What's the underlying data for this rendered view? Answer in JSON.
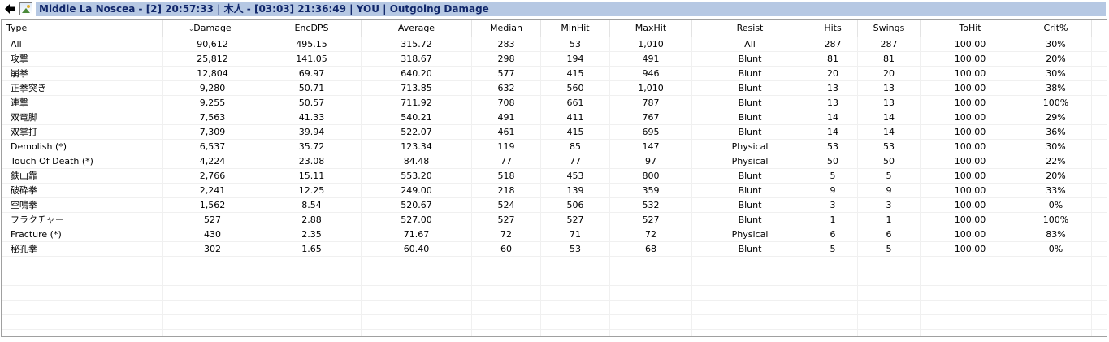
{
  "window": {
    "title": "Middle La Noscea - [2] 20:57:33 | 木人 - [03:03] 21:36:49 | YOU | Outgoing Damage",
    "back_icon": "back-arrow-icon",
    "image_icon": "picture-icon"
  },
  "table": {
    "columns": [
      "Type",
      "Damage",
      "EncDPS",
      "Average",
      "Median",
      "MinHit",
      "MaxHit",
      "Resist",
      "Hits",
      "Swings",
      "ToHit",
      "Crit%"
    ],
    "sorted_by": "Damage",
    "rows": [
      [
        "All",
        "90,612",
        "495.15",
        "315.72",
        "283",
        "53",
        "1,010",
        "All",
        "287",
        "287",
        "100.00",
        "30%"
      ],
      [
        "攻撃",
        "25,812",
        "141.05",
        "318.67",
        "298",
        "194",
        "491",
        "Blunt",
        "81",
        "81",
        "100.00",
        "20%"
      ],
      [
        "崩拳",
        "12,804",
        "69.97",
        "640.20",
        "577",
        "415",
        "946",
        "Blunt",
        "20",
        "20",
        "100.00",
        "30%"
      ],
      [
        "正拳突き",
        "9,280",
        "50.71",
        "713.85",
        "632",
        "560",
        "1,010",
        "Blunt",
        "13",
        "13",
        "100.00",
        "38%"
      ],
      [
        "連撃",
        "9,255",
        "50.57",
        "711.92",
        "708",
        "661",
        "787",
        "Blunt",
        "13",
        "13",
        "100.00",
        "100%"
      ],
      [
        "双竜脚",
        "7,563",
        "41.33",
        "540.21",
        "491",
        "411",
        "767",
        "Blunt",
        "14",
        "14",
        "100.00",
        "29%"
      ],
      [
        "双掌打",
        "7,309",
        "39.94",
        "522.07",
        "461",
        "415",
        "695",
        "Blunt",
        "14",
        "14",
        "100.00",
        "36%"
      ],
      [
        "Demolish (*)",
        "6,537",
        "35.72",
        "123.34",
        "119",
        "85",
        "147",
        "Physical",
        "53",
        "53",
        "100.00",
        "30%"
      ],
      [
        "Touch Of Death (*)",
        "4,224",
        "23.08",
        "84.48",
        "77",
        "77",
        "97",
        "Physical",
        "50",
        "50",
        "100.00",
        "22%"
      ],
      [
        "鉄山靠",
        "2,766",
        "15.11",
        "553.20",
        "518",
        "453",
        "800",
        "Blunt",
        "5",
        "5",
        "100.00",
        "20%"
      ],
      [
        "破砕拳",
        "2,241",
        "12.25",
        "249.00",
        "218",
        "139",
        "359",
        "Blunt",
        "9",
        "9",
        "100.00",
        "33%"
      ],
      [
        "空鳴拳",
        "1,562",
        "8.54",
        "520.67",
        "524",
        "506",
        "532",
        "Blunt",
        "3",
        "3",
        "100.00",
        "0%"
      ],
      [
        "フラクチャー",
        "527",
        "2.88",
        "527.00",
        "527",
        "527",
        "527",
        "Blunt",
        "1",
        "1",
        "100.00",
        "100%"
      ],
      [
        "Fracture (*)",
        "430",
        "2.35",
        "71.67",
        "72",
        "71",
        "72",
        "Physical",
        "6",
        "6",
        "100.00",
        "83%"
      ],
      [
        "秘孔拳",
        "302",
        "1.65",
        "60.40",
        "60",
        "53",
        "68",
        "Blunt",
        "5",
        "5",
        "100.00",
        "0%"
      ]
    ]
  }
}
